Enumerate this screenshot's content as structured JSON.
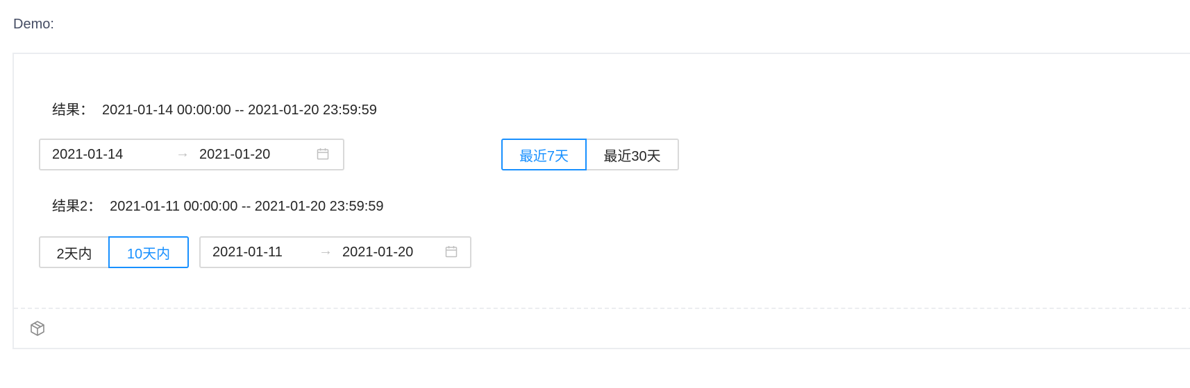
{
  "demo_label": "Demo:",
  "result1": {
    "label": "结果：",
    "value": "2021-01-14 00:00:00 -- 2021-01-20 23:59:59"
  },
  "picker1": {
    "start": "2021-01-14",
    "separator": "→",
    "end": "2021-01-20",
    "icon": "calendar-icon"
  },
  "range_buttons": {
    "last7": "最近7天",
    "last30": "最近30天",
    "active": "last7"
  },
  "result2": {
    "label": "结果2：",
    "value": "2021-01-11 00:00:00 -- 2021-01-20 23:59:59"
  },
  "within_buttons": {
    "two_days": "2天内",
    "ten_days": "10天内",
    "active": "ten_days"
  },
  "picker2": {
    "start": "2021-01-11",
    "separator": "→",
    "end": "2021-01-20",
    "icon": "calendar-icon"
  },
  "footer": {
    "icon": "code-sandbox-icon"
  },
  "colors": {
    "accent": "#1890ff",
    "border": "#d9d9d9",
    "text": "#262626",
    "muted": "#bfbfbf"
  }
}
